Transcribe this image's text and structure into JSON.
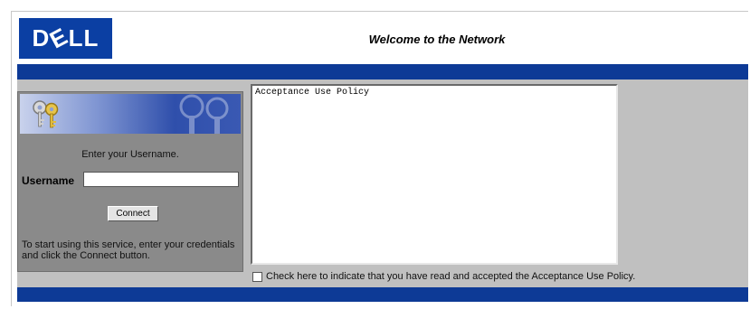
{
  "header": {
    "logo_text": "DELL",
    "welcome": "Welcome to the Network"
  },
  "login": {
    "prompt": "Enter your Username.",
    "username_label": "Username",
    "username_value": "",
    "connect_label": "Connect",
    "help_text": "To start using this service, enter your credentials and click the Connect button."
  },
  "policy": {
    "text": "Acceptance Use Policy",
    "accept_label": "Check here to indicate that you have read and accepted the Acceptance Use Policy.",
    "accepted": false
  },
  "colors": {
    "brand_blue": "#0b3fa3",
    "bar_blue": "#0d3a96",
    "panel_gray": "#8a8a8a",
    "body_gray": "#c0c0c0"
  }
}
